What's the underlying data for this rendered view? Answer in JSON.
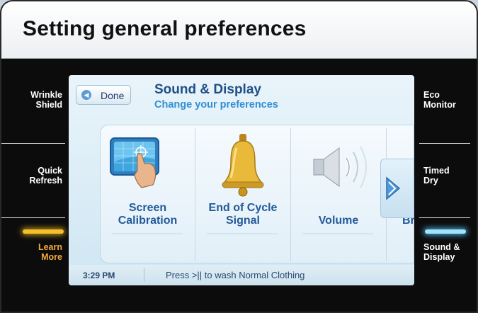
{
  "header": {
    "title": "Setting general preferences"
  },
  "left_buttons": [
    {
      "label_line1": "Wrinkle",
      "label_line2": "Shield"
    },
    {
      "label_line1": "Quick",
      "label_line2": "Refresh"
    },
    {
      "label_line1": "Learn",
      "label_line2": "More",
      "color": "#f2a83a"
    }
  ],
  "right_buttons": [
    {
      "label_line1": "Eco",
      "label_line2": "Monitor"
    },
    {
      "label_line1": "Timed",
      "label_line2": "Dry"
    },
    {
      "label_line1": "Sound &",
      "label_line2": "Display"
    }
  ],
  "screen": {
    "done_label": "Done",
    "title": "Sound & Display",
    "subtitle": "Change your preferences",
    "items": [
      {
        "line1": "Screen",
        "line2": "Calibration",
        "icon": "touch-screen-icon"
      },
      {
        "line1": "End of Cycle",
        "line2": "Signal",
        "icon": "bell-icon"
      },
      {
        "line1": "Volume",
        "line2": "",
        "icon": "speaker-icon"
      },
      {
        "line1": "Br",
        "line2": "",
        "icon": "brightness-icon"
      }
    ],
    "footer": {
      "time": "3:29 PM",
      "message": "Press >|| to wash Normal Clothing"
    }
  },
  "colors": {
    "accent_amber": "#f4c12a",
    "accent_blue": "#9fe3ff",
    "title_blue": "#1f4f86"
  }
}
